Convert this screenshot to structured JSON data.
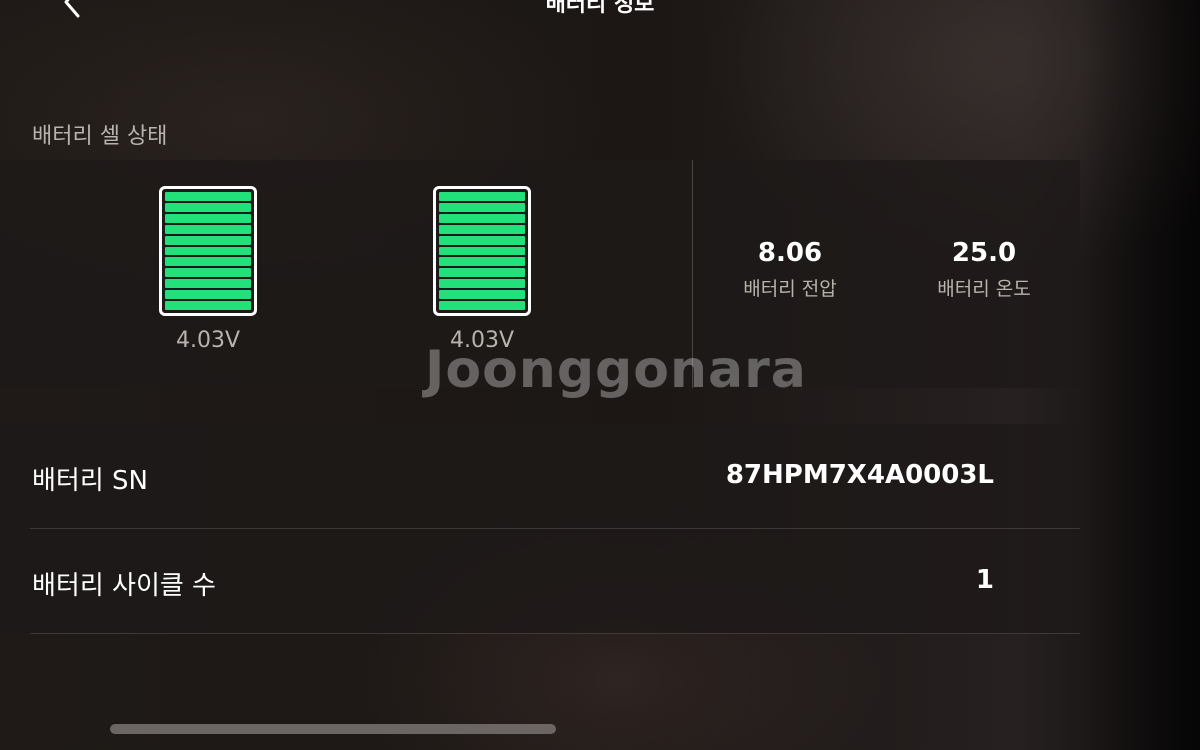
{
  "header": {
    "title": "배터리 정보"
  },
  "cells_section": {
    "label": "배터리 셀 상태",
    "cells": [
      {
        "voltage": "4.03V",
        "level": 1.0
      },
      {
        "voltage": "4.03V",
        "level": 1.0
      }
    ],
    "stats": {
      "voltage_value": "8.06",
      "voltage_label": "배터리 전압",
      "temperature_value": "25.0",
      "temperature_label": "배터리 온도"
    }
  },
  "info": {
    "rows": [
      {
        "key": "배터리 SN",
        "value": "87HPM7X4A0003L"
      },
      {
        "key": "배터리 사이클 수",
        "value": "1"
      }
    ]
  },
  "watermark": "Joonggonara",
  "icons": {
    "back": "chevron-left-icon",
    "cell": "battery-cell-icon"
  },
  "colors": {
    "cell_fill": "#22e07a",
    "background": "#1c1715"
  }
}
